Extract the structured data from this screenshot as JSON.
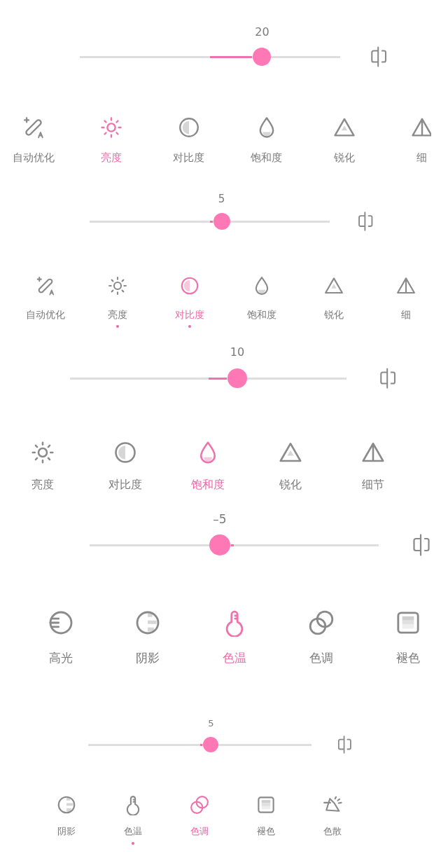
{
  "panels": [
    {
      "slider": {
        "value": "20",
        "level": 0.7
      },
      "tools": [
        {
          "kind": "auto",
          "label": "自动优化",
          "selected": false,
          "edited": false
        },
        {
          "kind": "brightness",
          "label": "亮度",
          "selected": true,
          "edited": false
        },
        {
          "kind": "contrast",
          "label": "对比度",
          "selected": false,
          "edited": false
        },
        {
          "kind": "saturation",
          "label": "饱和度",
          "selected": false,
          "edited": false
        },
        {
          "kind": "sharpen",
          "label": "锐化",
          "selected": false,
          "edited": false
        },
        {
          "kind": "detail",
          "label": "细",
          "selected": false,
          "edited": false
        }
      ]
    },
    {
      "slider": {
        "value": "5",
        "level": 0.55
      },
      "tools": [
        {
          "kind": "auto",
          "label": "自动优化",
          "selected": false,
          "edited": false
        },
        {
          "kind": "brightness",
          "label": "亮度",
          "selected": false,
          "edited": true
        },
        {
          "kind": "contrast",
          "label": "对比度",
          "selected": true,
          "edited": true
        },
        {
          "kind": "saturation",
          "label": "饱和度",
          "selected": false,
          "edited": false
        },
        {
          "kind": "sharpen",
          "label": "锐化",
          "selected": false,
          "edited": false
        },
        {
          "kind": "detail",
          "label": "细",
          "selected": false,
          "edited": false
        }
      ]
    },
    {
      "slider": {
        "value": "10",
        "level": 0.605
      },
      "tools": [
        {
          "kind": "brightness",
          "label": "亮度",
          "selected": false,
          "edited": false
        },
        {
          "kind": "contrast",
          "label": "对比度",
          "selected": false,
          "edited": false
        },
        {
          "kind": "saturation",
          "label": "饱和度",
          "selected": true,
          "edited": false
        },
        {
          "kind": "sharpen",
          "label": "锐化",
          "selected": false,
          "edited": false
        },
        {
          "kind": "detail",
          "label": "细节",
          "selected": false,
          "edited": false
        }
      ]
    },
    {
      "slider": {
        "value": "–5",
        "level": 0.45
      },
      "tools": [
        {
          "kind": "highlight",
          "label": "高光",
          "selected": false,
          "edited": false
        },
        {
          "kind": "shadow",
          "label": "阴影",
          "selected": false,
          "edited": false
        },
        {
          "kind": "temperature",
          "label": "色温",
          "selected": true,
          "edited": false
        },
        {
          "kind": "tone",
          "label": "色调",
          "selected": false,
          "edited": false
        },
        {
          "kind": "fade",
          "label": "褪色",
          "selected": false,
          "edited": false
        }
      ]
    },
    {
      "slider": {
        "value": "5",
        "level": 0.55
      },
      "tools": [
        {
          "kind": "shadow",
          "label": "阴影",
          "selected": false,
          "edited": false
        },
        {
          "kind": "temperature",
          "label": "色温",
          "selected": false,
          "edited": true
        },
        {
          "kind": "tone",
          "label": "色调",
          "selected": true,
          "edited": false
        },
        {
          "kind": "fade",
          "label": "褪色",
          "selected": false,
          "edited": false
        },
        {
          "kind": "dispersion",
          "label": "色散",
          "selected": false,
          "edited": false
        }
      ]
    }
  ]
}
